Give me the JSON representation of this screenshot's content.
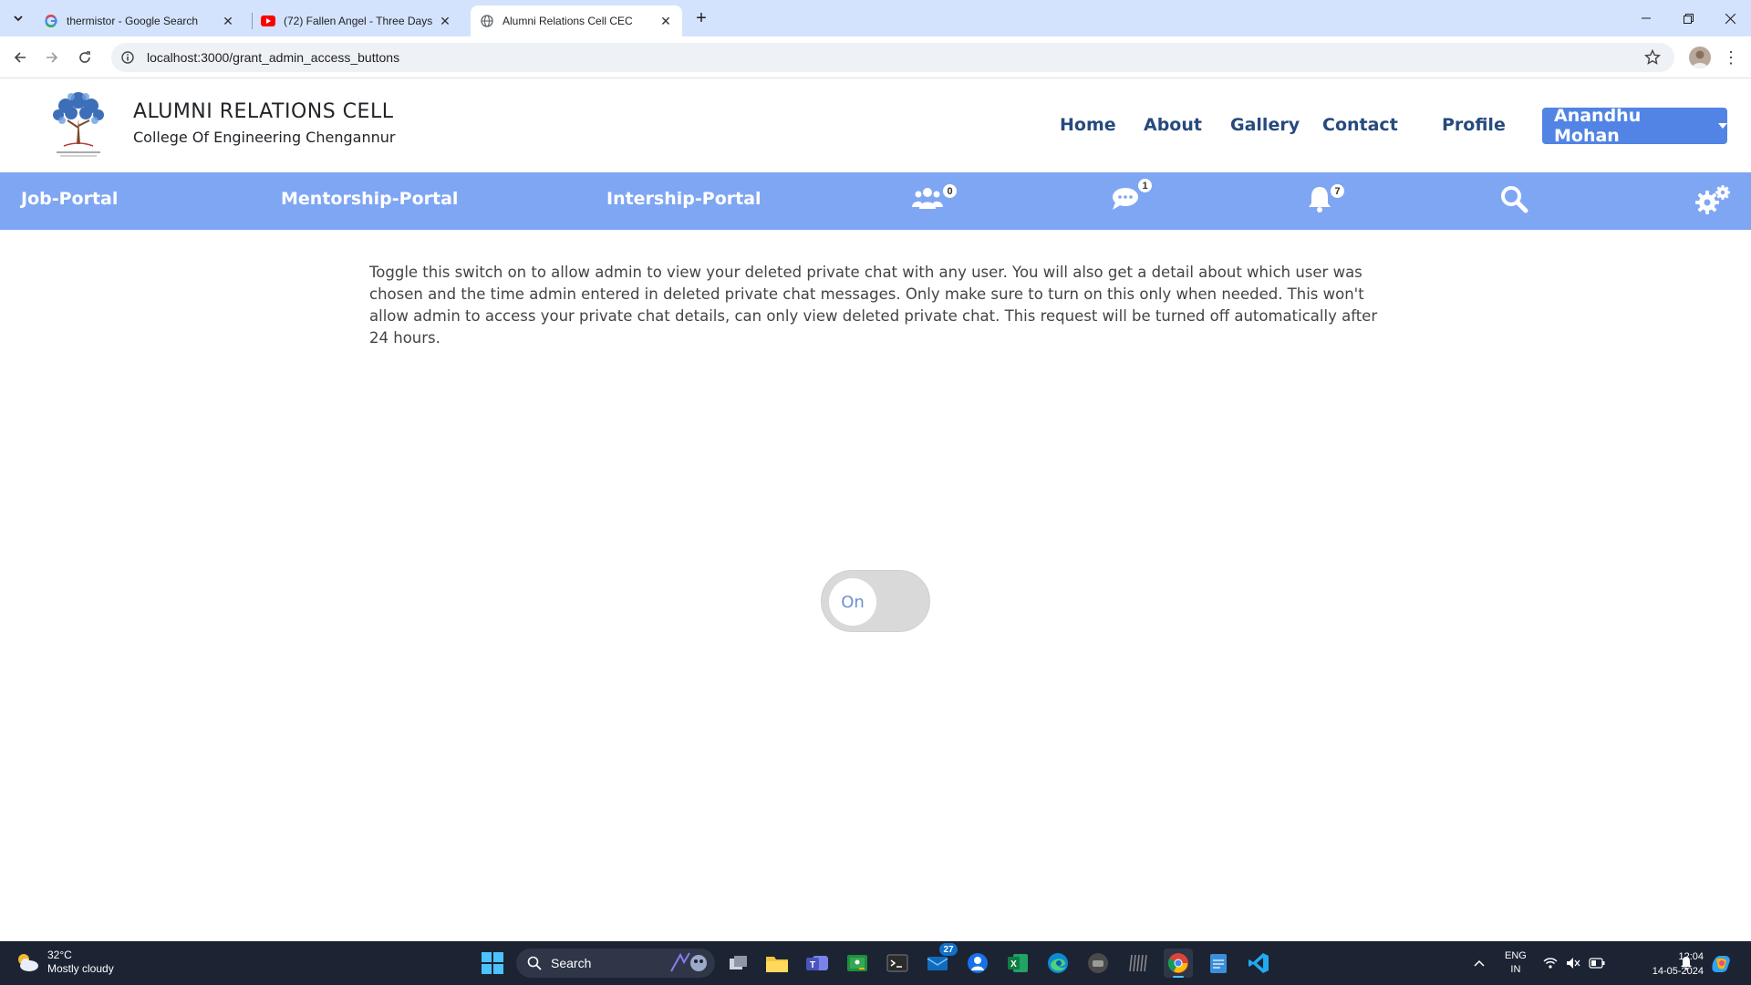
{
  "browser": {
    "tabs": [
      {
        "title": "thermistor - Google Search",
        "favicon": "google-icon",
        "active": false
      },
      {
        "title": "(72) Fallen Angel - Three Days G",
        "favicon": "youtube-icon",
        "active": false
      },
      {
        "title": "Alumni Relations Cell CEC",
        "favicon": "globe-icon",
        "active": true
      }
    ],
    "url": "localhost:3000/grant_admin_access_buttons"
  },
  "header": {
    "title": "ALUMNI RELATIONS CELL",
    "subtitle": "College Of Engineering Chengannur",
    "nav": [
      "Home",
      "About",
      "Gallery",
      "Contact",
      "Profile"
    ],
    "user": "Anandhu Mohan"
  },
  "portalbar": {
    "links": [
      "Job-Portal",
      "Mentorship-Portal",
      "Intership-Portal"
    ],
    "badges": {
      "friends": "0",
      "messages": "1",
      "notifications": "7"
    }
  },
  "main": {
    "description": "Toggle this switch on to allow admin to view your deleted private chat with any user. You will also get a detail about which user was chosen and the time admin entered in deleted private chat messages. Only make sure to turn on this only when needed. This won't allow admin to access your private chat details, can only view deleted private chat. This request will be turned off automatically after 24 hours.",
    "toggle_label": "On"
  },
  "taskbar": {
    "weather_temp": "32°C",
    "weather_desc": "Mostly cloudy",
    "search_label": "Search",
    "mail_badge": "27",
    "lang_top": "ENG",
    "lang_bottom": "IN",
    "time": "12:04",
    "date": "14-05-2024"
  },
  "colors": {
    "tabstrip": "#d3e3fd",
    "nav_text": "#274a7e",
    "user_button": "#5184e4",
    "portal_bar": "#7fa6f3",
    "taskbar": "#1c2333"
  }
}
